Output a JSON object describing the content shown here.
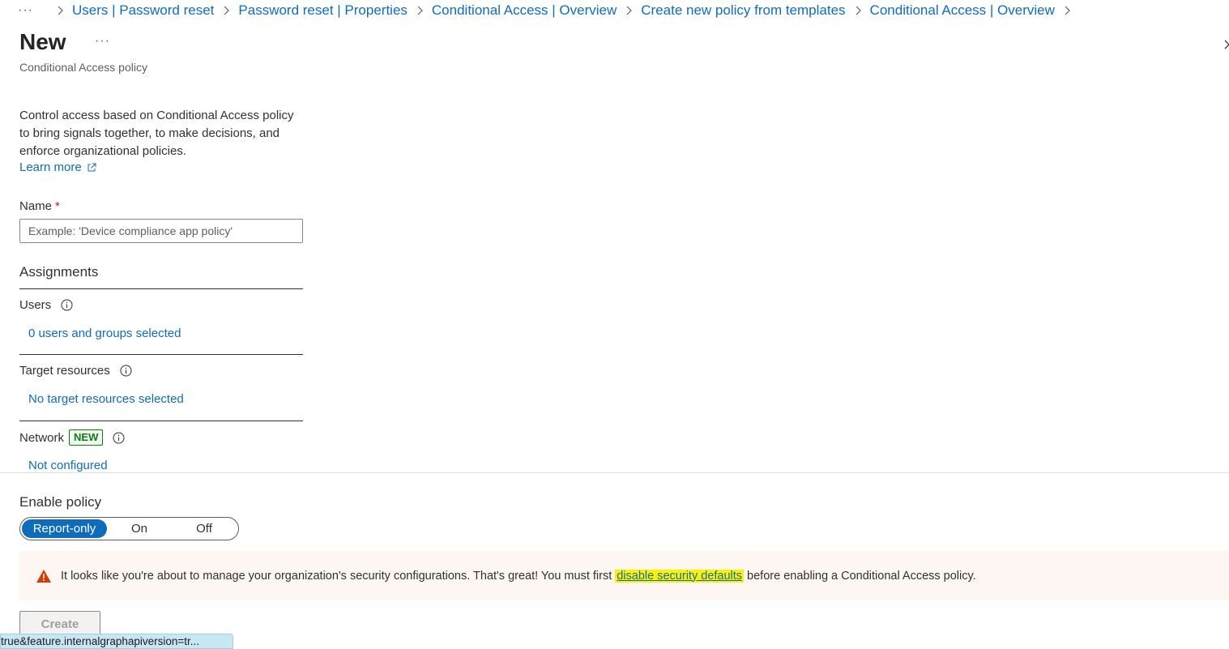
{
  "breadcrumb": {
    "ellipsis": "···",
    "items": [
      "Users | Password reset",
      "Password reset | Properties",
      "Conditional Access | Overview",
      "Create new policy from templates",
      "Conditional Access | Overview"
    ]
  },
  "header": {
    "title": "New",
    "more": "···",
    "subtitle": "Conditional Access policy"
  },
  "intro": {
    "description": "Control access based on Conditional Access policy to bring signals together, to make decisions, and enforce organizational policies.",
    "learn_more": "Learn more"
  },
  "name_field": {
    "label": "Name",
    "required_marker": "*",
    "value": "",
    "placeholder": "Example: 'Device compliance app policy'"
  },
  "assignments": {
    "heading": "Assignments",
    "users_label": "Users",
    "users_value": "0 users and groups selected",
    "target_label": "Target resources",
    "target_value": "No target resources selected",
    "network_label": "Network",
    "network_badge": "NEW",
    "network_value": "Not configured"
  },
  "enable_policy": {
    "label": "Enable policy",
    "options": [
      "Report-only",
      "On",
      "Off"
    ],
    "selected": "Report-only"
  },
  "warning": {
    "text_before": "It looks like you're about to manage your organization's security configurations. That's great! You must first",
    "link": "disable security defaults",
    "text_after": "before enabling a Conditional Access policy.",
    "icon": "warning-triangle-icon",
    "color": "#d83b01"
  },
  "actions": {
    "create_label": "Create"
  },
  "status_bar": {
    "url": "true&feature.internalgraphapiversion=tr..."
  },
  "colors": {
    "link": "#0f6cbd",
    "accent": "#0f6cbd",
    "highlight": "#fff200",
    "badge_green": "#107c10"
  }
}
